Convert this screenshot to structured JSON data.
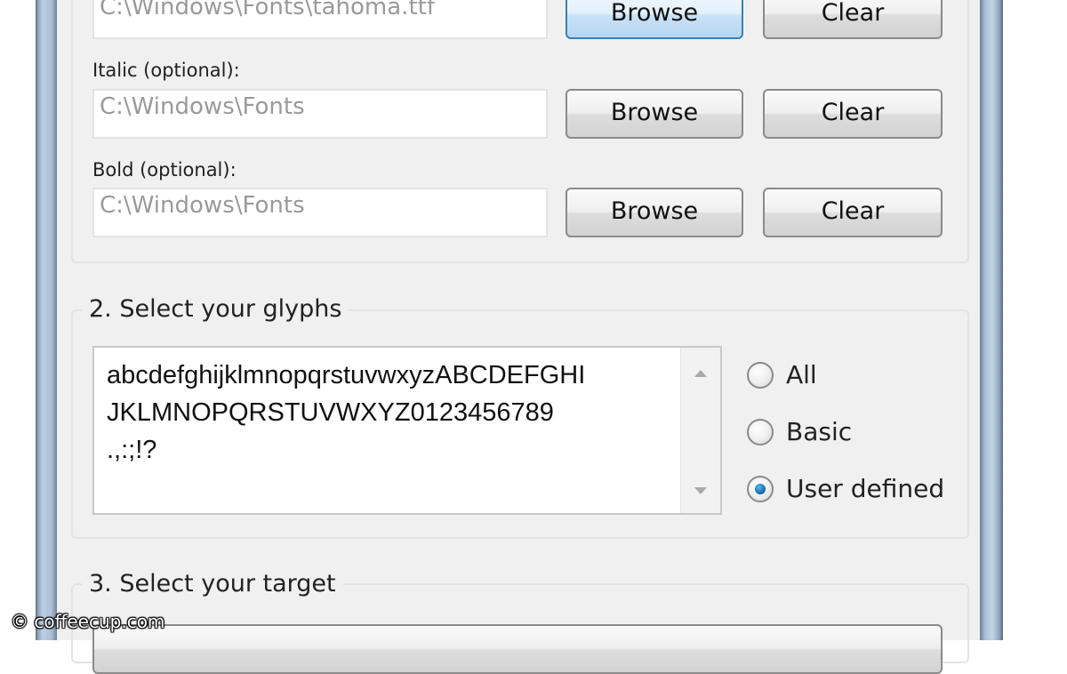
{
  "font_section": {
    "regular": {
      "value": "C:\\Windows\\Fonts\\tahoma.ttf",
      "browse_label": "Browse",
      "clear_label": "Clear"
    },
    "italic": {
      "label": "Italic (optional):",
      "value": "C:\\Windows\\Fonts",
      "browse_label": "Browse",
      "clear_label": "Clear"
    },
    "bold": {
      "label": "Bold (optional):",
      "value": "C:\\Windows\\Fonts",
      "browse_label": "Browse",
      "clear_label": "Clear"
    }
  },
  "glyphs_section": {
    "title": "2. Select your glyphs",
    "text": "abcdefghijklmnopqrstuvwxyzABCDEFGHI\nJKLMNOPQRSTUVWXYZ0123456789\n.,:;!?",
    "options": [
      {
        "label": "All",
        "selected": false
      },
      {
        "label": "Basic",
        "selected": false
      },
      {
        "label": "User defined",
        "selected": true
      }
    ]
  },
  "target_section": {
    "title": "3. Select your target"
  },
  "watermark": "© coffeecup.com",
  "colors": {
    "focus_border": "#3c7fb1",
    "radio_selected": "#1a6fb0"
  }
}
